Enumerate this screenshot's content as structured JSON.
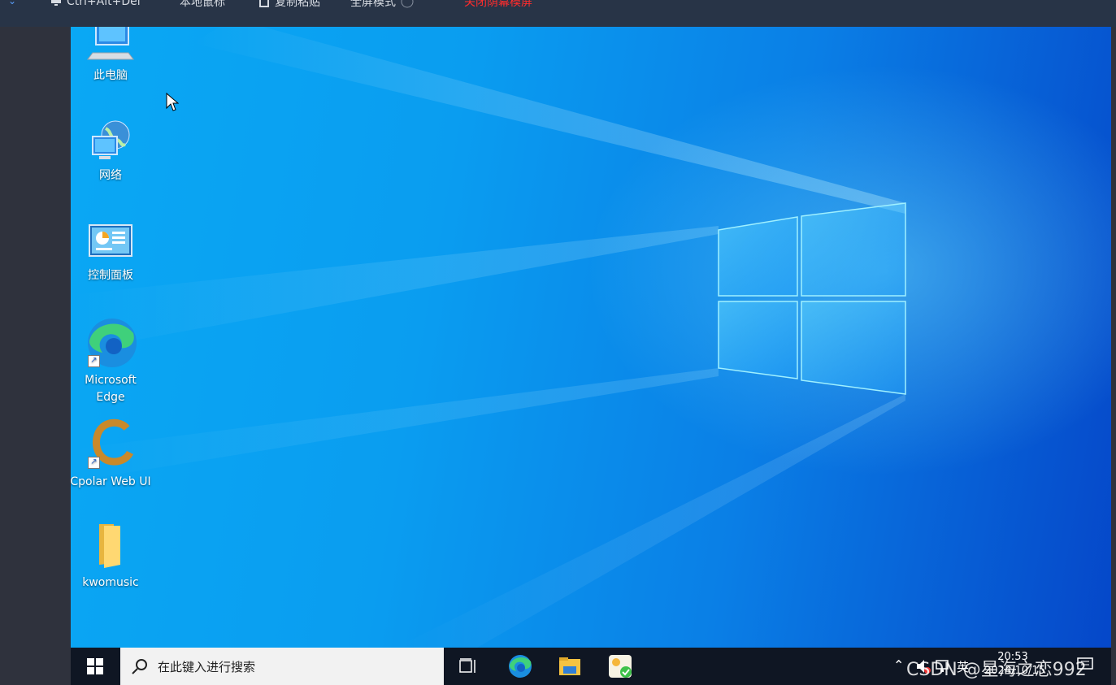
{
  "toolbar": {
    "items": [
      {
        "label": "Ctrl+Alt+Del"
      },
      {
        "label": "本地鼠标"
      },
      {
        "label": "复制粘贴"
      },
      {
        "label": "全屏模式"
      },
      {
        "label": "关闭荫幕模屏"
      }
    ]
  },
  "desktop": {
    "icons": [
      {
        "label": "此电脑",
        "icon": "this-pc-icon"
      },
      {
        "label": "网络",
        "icon": "network-icon"
      },
      {
        "label": "控制面板",
        "icon": "control-panel-icon"
      },
      {
        "label": "Microsoft Edge",
        "icon": "edge-icon"
      },
      {
        "label": "Cpolar Web UI",
        "icon": "cpolar-icon"
      },
      {
        "label": "kwomusic",
        "icon": "folder-icon"
      }
    ]
  },
  "taskbar": {
    "search_placeholder": "在此键入进行搜索",
    "pinned": [
      "task-view-icon",
      "edge-icon",
      "file-explorer-icon",
      "app-icon"
    ],
    "tray": {
      "ime": "英",
      "time": "20:53",
      "date": "2024/10/15"
    }
  },
  "watermark": "CSDN @星海之恋992",
  "colors": {
    "wallpaper_light": "#0aa8f4",
    "wallpaper_dark": "#0547c9",
    "taskbar": "#0f1623",
    "toolbar": "#283447",
    "toolbar_alert": "#ff2c2c"
  }
}
